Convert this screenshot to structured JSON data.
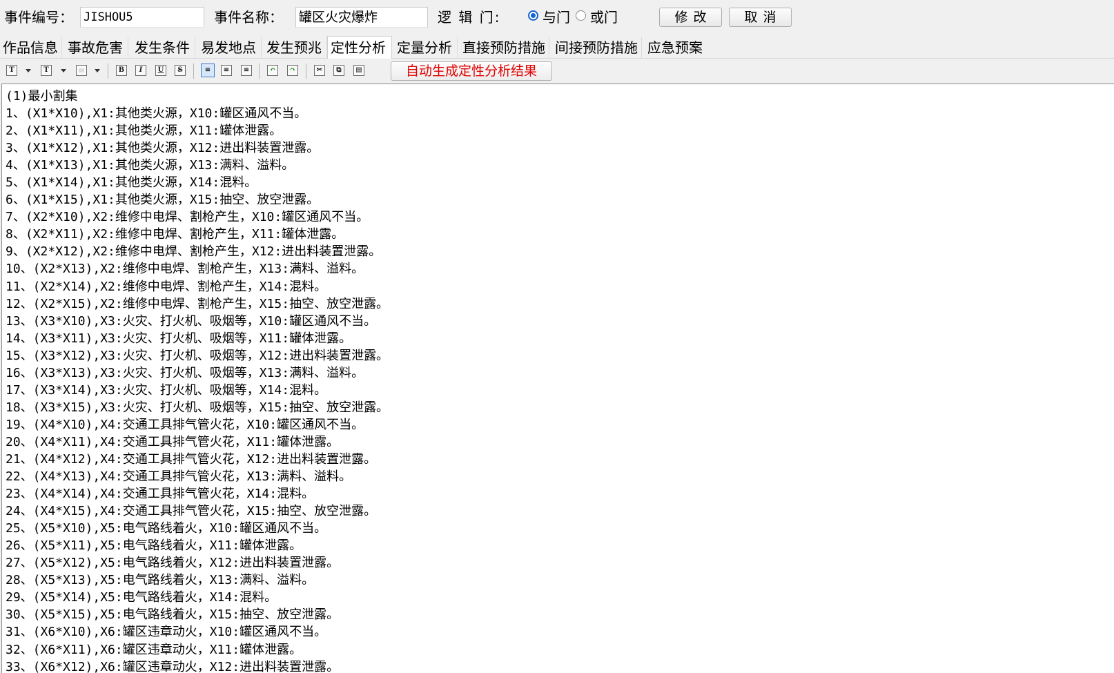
{
  "header": {
    "event_id_label": "事件编号：",
    "event_id_value": "JISHOU5",
    "event_name_label": "事件名称：",
    "event_name_value": "罐区火灾爆炸",
    "logic_gate_label": "逻 辑 门:",
    "gate_and_label": "与门",
    "gate_or_label": "或门",
    "gate_selected": "与门",
    "modify_button": "修改",
    "cancel_button": "取消"
  },
  "tabs": [
    {
      "label": "作品信息"
    },
    {
      "label": "事故危害"
    },
    {
      "label": "发生条件"
    },
    {
      "label": "易发地点"
    },
    {
      "label": "发生预兆"
    },
    {
      "label": "定性分析",
      "active": true
    },
    {
      "label": "定量分析"
    },
    {
      "label": "直接预防措施"
    },
    {
      "label": "间接预防措施"
    },
    {
      "label": "应急预案"
    }
  ],
  "toolbar": {
    "icons": [
      {
        "name": "font-icon",
        "glyph": "T"
      },
      {
        "name": "font-size-icon",
        "glyph": "T"
      },
      {
        "name": "color-icon",
        "glyph": ""
      },
      {
        "name": "bold-icon",
        "glyph": "B"
      },
      {
        "name": "italic-icon",
        "glyph": "I"
      },
      {
        "name": "underline-icon",
        "glyph": "U"
      },
      {
        "name": "strikethrough-icon",
        "glyph": "S"
      },
      {
        "name": "align-left-icon",
        "glyph": "≡"
      },
      {
        "name": "align-center-icon",
        "glyph": "≡"
      },
      {
        "name": "align-right-icon",
        "glyph": "≡"
      },
      {
        "name": "undo-icon",
        "glyph": "↶"
      },
      {
        "name": "redo-icon",
        "glyph": "↷"
      },
      {
        "name": "cut-icon",
        "glyph": "✂"
      },
      {
        "name": "copy-icon",
        "glyph": "⧉"
      },
      {
        "name": "paste-icon",
        "glyph": "▤"
      }
    ],
    "auto_generate_button": "自动生成定性分析结果",
    "accent_red": "#e00000"
  },
  "editor": {
    "lines": [
      "(1)最小割集",
      "1、(X1*X10),X1:其他类火源，X10:罐区通风不当。",
      "2、(X1*X11),X1:其他类火源，X11:罐体泄露。",
      "3、(X1*X12),X1:其他类火源，X12:进出料装置泄露。",
      "4、(X1*X13),X1:其他类火源，X13:满料、溢料。",
      "5、(X1*X14),X1:其他类火源，X14:混料。",
      "6、(X1*X15),X1:其他类火源，X15:抽空、放空泄露。",
      "7、(X2*X10),X2:维修中电焊、割枪产生，X10:罐区通风不当。",
      "8、(X2*X11),X2:维修中电焊、割枪产生，X11:罐体泄露。",
      "9、(X2*X12),X2:维修中电焊、割枪产生，X12:进出料装置泄露。",
      "10、(X2*X13),X2:维修中电焊、割枪产生，X13:满料、溢料。",
      "11、(X2*X14),X2:维修中电焊、割枪产生，X14:混料。",
      "12、(X2*X15),X2:维修中电焊、割枪产生，X15:抽空、放空泄露。",
      "13、(X3*X10),X3:火灾、打火机、吸烟等，X10:罐区通风不当。",
      "14、(X3*X11),X3:火灾、打火机、吸烟等，X11:罐体泄露。",
      "15、(X3*X12),X3:火灾、打火机、吸烟等，X12:进出料装置泄露。",
      "16、(X3*X13),X3:火灾、打火机、吸烟等，X13:满料、溢料。",
      "17、(X3*X14),X3:火灾、打火机、吸烟等，X14:混料。",
      "18、(X3*X15),X3:火灾、打火机、吸烟等，X15:抽空、放空泄露。",
      "19、(X4*X10),X4:交通工具排气管火花，X10:罐区通风不当。",
      "20、(X4*X11),X4:交通工具排气管火花，X11:罐体泄露。",
      "21、(X4*X12),X4:交通工具排气管火花，X12:进出料装置泄露。",
      "22、(X4*X13),X4:交通工具排气管火花，X13:满料、溢料。",
      "23、(X4*X14),X4:交通工具排气管火花，X14:混料。",
      "24、(X4*X15),X4:交通工具排气管火花，X15:抽空、放空泄露。",
      "25、(X5*X10),X5:电气路线着火，X10:罐区通风不当。",
      "26、(X5*X11),X5:电气路线着火，X11:罐体泄露。",
      "27、(X5*X12),X5:电气路线着火，X12:进出料装置泄露。",
      "28、(X5*X13),X5:电气路线着火，X13:满料、溢料。",
      "29、(X5*X14),X5:电气路线着火，X14:混料。",
      "30、(X5*X15),X5:电气路线着火，X15:抽空、放空泄露。",
      "31、(X6*X10),X6:罐区违章动火，X10:罐区通风不当。",
      "32、(X6*X11),X6:罐区违章动火，X11:罐体泄露。",
      "33、(X6*X12),X6:罐区违章动火，X12:进出料装置泄露。"
    ]
  }
}
